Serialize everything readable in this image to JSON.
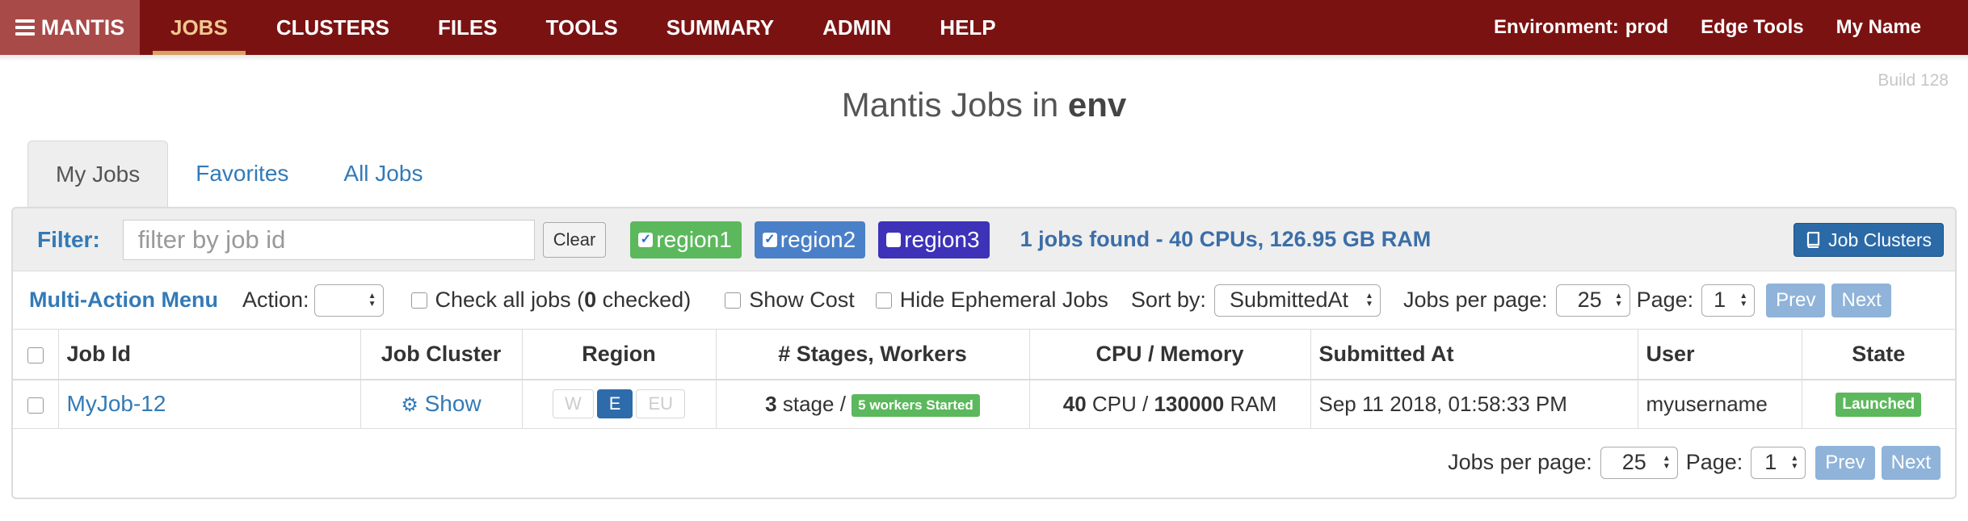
{
  "nav": {
    "brand": "MANTIS",
    "items": [
      "JOBS",
      "CLUSTERS",
      "FILES",
      "TOOLS",
      "SUMMARY",
      "ADMIN",
      "HELP"
    ],
    "environment_label": "Environment:",
    "environment_value": "prod",
    "edge_tools": "Edge Tools",
    "user_name": "My Name"
  },
  "build": "Build 128",
  "title": {
    "prefix": "Mantis Jobs in",
    "env": "env"
  },
  "tabs": [
    "My Jobs",
    "Favorites",
    "All Jobs"
  ],
  "filter": {
    "label": "Filter:",
    "placeholder": "filter by job id",
    "clear": "Clear",
    "regions": [
      "region1",
      "region2",
      "region3"
    ],
    "found_prefix": "1 jobs found - ",
    "cpus": "40",
    "cpus_label": " CPUs, ",
    "ram": "126.95 GB",
    "ram_label": " RAM",
    "job_clusters": "Job Clusters"
  },
  "actions": {
    "multi_action_menu": "Multi-Action Menu",
    "action_label": "Action:",
    "check_all_prefix": "Check all jobs (",
    "checked_count": "0",
    "check_all_suffix": " checked)",
    "show_cost": "Show Cost",
    "hide_ephemeral": "Hide Ephemeral Jobs",
    "sort_label": "Sort by:",
    "sort_value": "SubmittedAt",
    "per_page_label": "Jobs per page:",
    "per_page_value": "25",
    "page_label": "Page:",
    "page_value": "1",
    "prev": "Prev",
    "next": "Next"
  },
  "table": {
    "headers": [
      "Job Id",
      "Job Cluster",
      "Region",
      "# Stages, Workers",
      "CPU / Memory",
      "Submitted At",
      "User",
      "State"
    ],
    "rows": [
      {
        "job_id": "MyJob-12",
        "cluster": "Show",
        "region_buttons": [
          "W",
          "E",
          "EU"
        ],
        "stages": "3",
        "stage_label": " stage / ",
        "workers_badge": "5 workers Started",
        "cpu": "40",
        "cpu_label": " CPU / ",
        "memory": "130000",
        "memory_label": " RAM",
        "submitted_at": "Sep 11 2018, 01:58:33 PM",
        "user": "myusername",
        "state": "Launched"
      }
    ]
  },
  "colors": {
    "nav_bg": "#7b1212",
    "link": "#337ab7",
    "region1": "#5cb85c",
    "region2": "#4a80c7",
    "region3": "#3d32b8",
    "launched": "#5cb85c"
  }
}
